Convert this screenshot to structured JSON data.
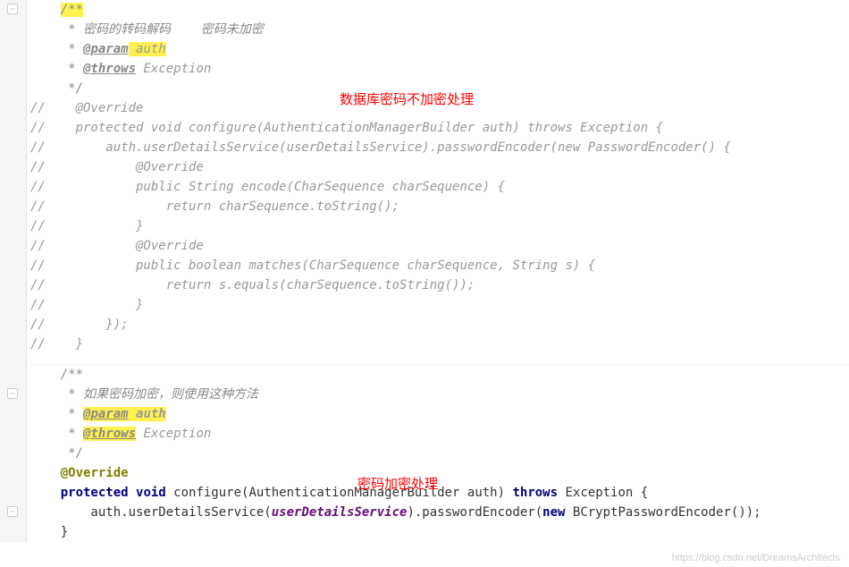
{
  "labels": {
    "top_red": "数据库密码不加密处理",
    "bottom_red": "密码加密处理"
  },
  "watermark": "https://blog.csdn.net/DreamsArchitects",
  "block1": {
    "l1": "/**",
    "l2": " * 密码的转码解码    密码未加密",
    "l3_pre": " * ",
    "l3_tag": "@param",
    "l3_param": " auth",
    "l4_pre": " * ",
    "l4_tag": "@throws",
    "l4_param": " Exception",
    "l5": " */",
    "l6_slash": "//",
    "l6": "    @Override",
    "l7_slash": "//",
    "l7": "    protected void configure(AuthenticationManagerBuilder auth) throws Exception {",
    "l8_slash": "//",
    "l8": "        auth.userDetailsService(userDetailsService).passwordEncoder(new PasswordEncoder() {",
    "l9_slash": "//",
    "l9": "            @Override",
    "l10_slash": "//",
    "l10": "            public String encode(CharSequence charSequence) {",
    "l11_slash": "//",
    "l11": "                return charSequence.toString();",
    "l12_slash": "//",
    "l12": "            }",
    "l13_slash": "//",
    "l13": "            @Override",
    "l14_slash": "//",
    "l14": "            public boolean matches(CharSequence charSequence, String s) {",
    "l15_slash": "//",
    "l15": "                return s.equals(charSequence.toString());",
    "l16_slash": "//",
    "l16": "            }",
    "l17_slash": "//",
    "l17": "        });",
    "l18_slash": "//",
    "l18": "    }"
  },
  "block2": {
    "l1": "/**",
    "l2": " * 如果密码加密，则使用这种方法",
    "l3_pre": " * ",
    "l3_tag": "@param",
    "l3_param": " auth",
    "l4_pre": " * ",
    "l4_tag": "@throws",
    "l4_param": " Exception",
    "l5": " */",
    "l6": "@Override",
    "l7_kw1": "protected",
    "l7_kw2": "void",
    "l7_method": " configure",
    "l7_args": "(AuthenticationManagerBuilder auth) ",
    "l7_kw3": "throws",
    "l7_exc": " Exception ",
    "l7_brace": "{",
    "l8_pre": "    auth.userDetailsService(",
    "l8_field": "userDetailsService",
    "l8_mid": ").passwordEncoder(",
    "l8_kw": "new",
    "l8_post": " BCryptPasswordEncoder());",
    "l9": "}"
  }
}
